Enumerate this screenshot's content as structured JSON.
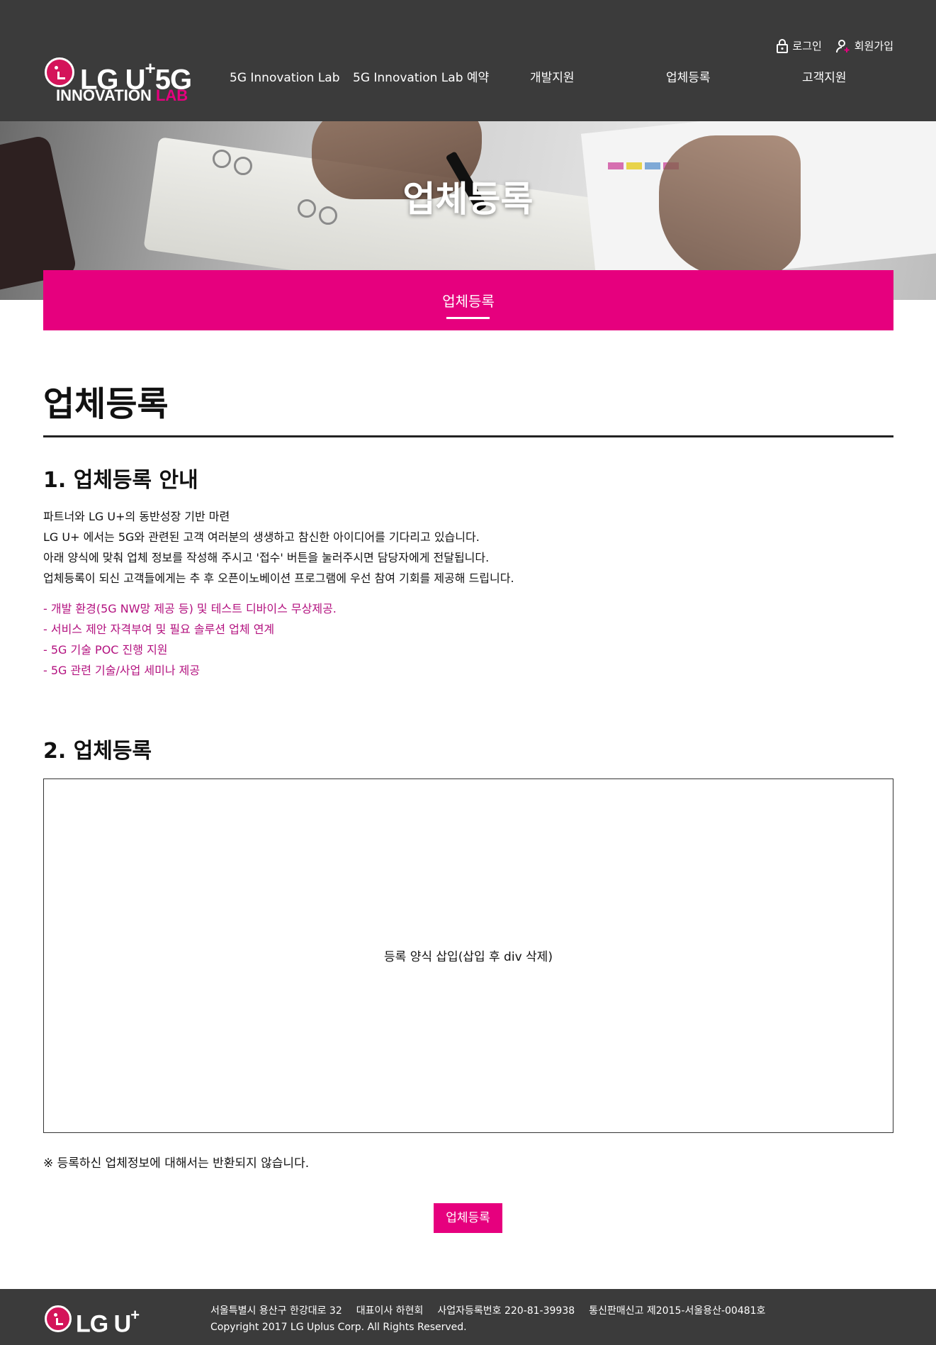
{
  "header": {
    "logo": {
      "brand": "LG U",
      "plus": "+",
      "suffix": "5G",
      "sub_main": "INNOVATION",
      "sub_accent": "LAB"
    },
    "util": {
      "login": "로그인",
      "signup": "회원가입"
    },
    "nav": [
      "5G Innovation Lab",
      "5G Innovation Lab 예약",
      "개발지원",
      "업체등록",
      "고객지원"
    ]
  },
  "visual": {
    "title": "업체등록"
  },
  "tabbar": {
    "active_tab": "업체등록"
  },
  "main": {
    "page_title": "업체등록",
    "section1": {
      "title": "1. 업체등록 안내",
      "intro": [
        "파트너와 LG U+의 동반성장 기반 마련",
        "LG U+ 에서는 5G와 관련된 고객 여러분의 생생하고 참신한 아이디어를 기다리고 있습니다.",
        "아래 양식에 맞춰 업체 정보를 작성해 주시고 '접수' 버튼을 눌러주시면 담당자에게 전달됩니다.",
        "업체등록이 되신 고객들에게는 추 후 오픈이노베이션 프로그램에 우선 참여 기회를 제공해 드립니다."
      ],
      "benefits": [
        "- 개발 환경(5G NW망 제공 등) 및 테스트 디바이스 무상제공.",
        "- 서비스 제안 자격부여 및 필요 솔루션 업체 연계",
        "- 5G 기술 POC 진행 지원",
        "- 5G 관련 기술/사업 세미나 제공"
      ]
    },
    "section2": {
      "title": "2. 업체등록",
      "form_placeholder": "등록 양식 삽입(삽입 후 div 삭제)"
    },
    "notice": "※ 등록하신 업체정보에 대해서는 반환되지 않습니다.",
    "submit_label": "업체등록"
  },
  "footer": {
    "logo": {
      "brand": "LG U",
      "plus": "+"
    },
    "address": "서울특별시 용산구 한강대로 32",
    "ceo": "대표이사 하현회",
    "biz_no": "사업자등록번호 220-81-39938",
    "mail_order": "통신판매신고 제2015-서울용산-00481호",
    "copyright": "Copyright 2017 LG Uplus Corp. All Rights Reserved."
  },
  "colors": {
    "accent": "#e6007e",
    "header_bg": "#3b3b3b",
    "benefit_text": "#b3117f"
  },
  "icons": [
    "lock-icon",
    "user-plus-icon",
    "lg-logo-icon"
  ]
}
